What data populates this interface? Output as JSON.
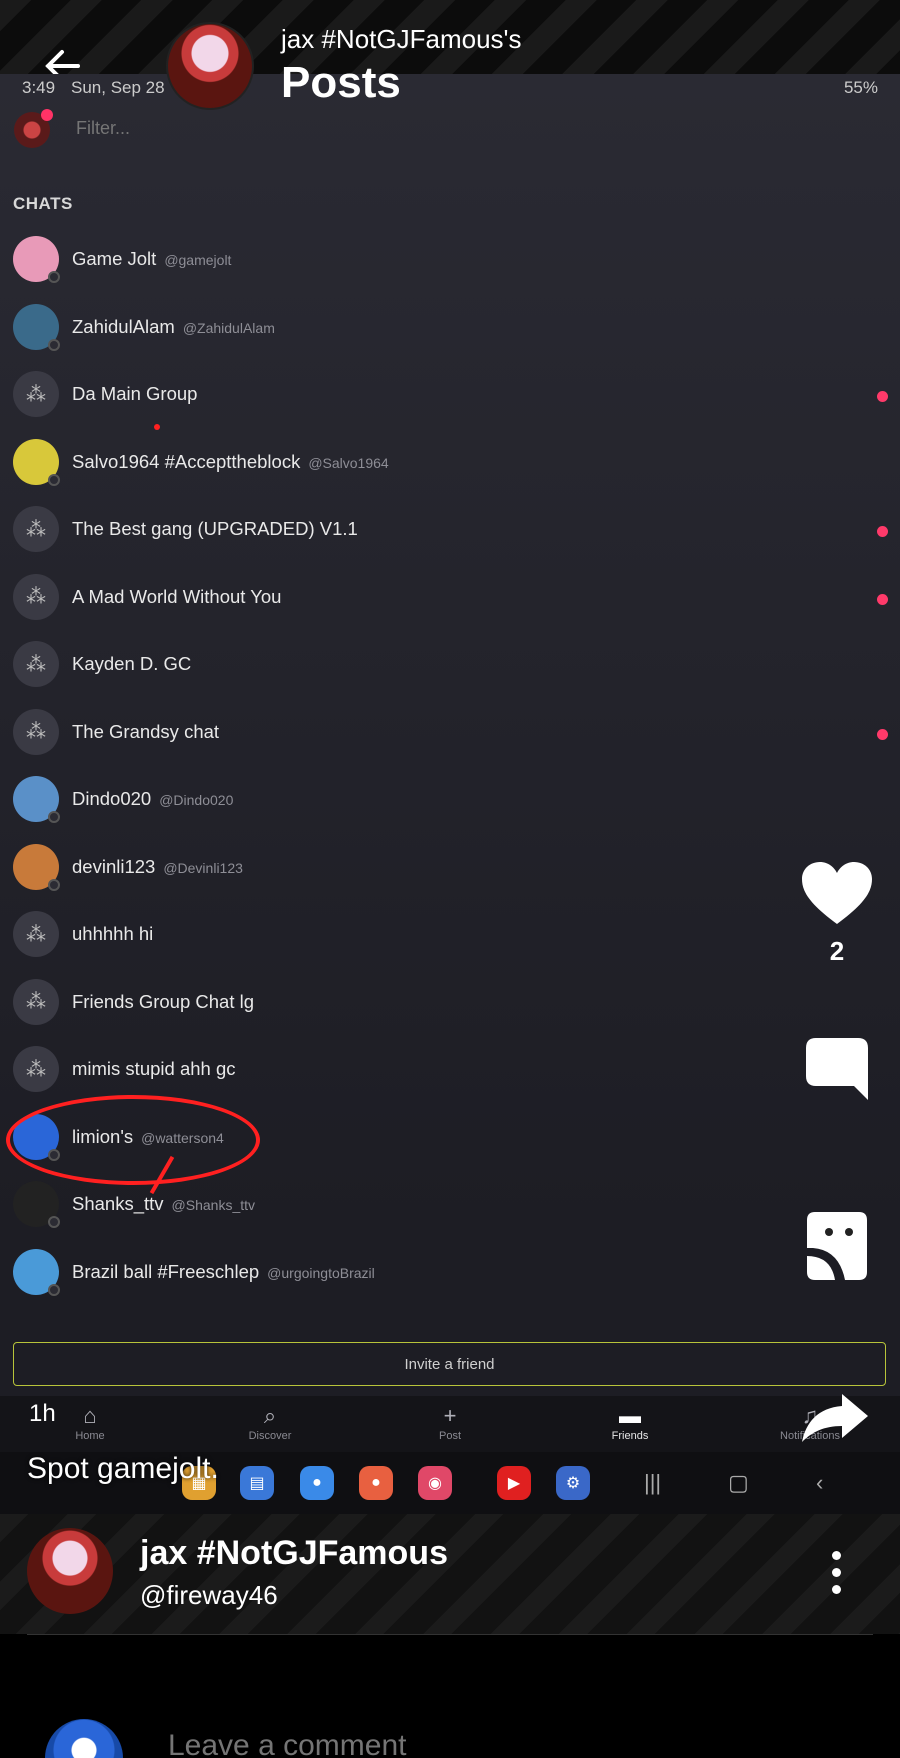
{
  "post": {
    "title": "jax #NotGJFamous's",
    "subtitle": "Posts",
    "age": "1h",
    "caption": "Spot gamejolt.",
    "likes": "2",
    "author_name": "jax #NotGJFamous",
    "author_handle": "@fireway46",
    "comment_placeholder": "Leave a comment"
  },
  "phone": {
    "time": "3:49",
    "date": "Sun, Sep 28",
    "battery": "55%",
    "filter_placeholder": "Filter...",
    "chats_label": "CHATS",
    "chats": [
      {
        "name": "Game Jolt",
        "handle": "@gamejolt",
        "unread": false
      },
      {
        "name": "ZahidulAlam",
        "handle": "@ZahidulAlam",
        "unread": false
      },
      {
        "name": "Da Main Group",
        "handle": "",
        "unread": true
      },
      {
        "name": "Salvo1964  #Accepttheblock",
        "handle": "@Salvo1964",
        "unread": false
      },
      {
        "name": "The Best gang (UPGRADED) V1.1",
        "handle": "",
        "unread": true
      },
      {
        "name": "A Mad World Without You",
        "handle": "",
        "unread": true
      },
      {
        "name": "Kayden D. GC",
        "handle": "",
        "unread": false
      },
      {
        "name": "The Grandsy chat",
        "handle": "",
        "unread": true
      },
      {
        "name": "Dindo020",
        "handle": "@Dindo020",
        "unread": false
      },
      {
        "name": "devinli123",
        "handle": "@Devinli123",
        "unread": false
      },
      {
        "name": "uhhhhh hi",
        "handle": "",
        "unread": false
      },
      {
        "name": "Friends Group Chat lg",
        "handle": "",
        "unread": false
      },
      {
        "name": "mimis stupid ahh gc",
        "handle": "",
        "unread": false
      },
      {
        "name": "limion's",
        "handle": "@watterson4",
        "unread": false
      },
      {
        "name": "Shanks_ttv",
        "handle": "@Shanks_ttv",
        "unread": false
      },
      {
        "name": "Brazil ball #Freeschlep",
        "handle": "@urgoingtoBrazil",
        "unread": false
      }
    ],
    "invite_label": "Invite a friend",
    "nav": {
      "home": "Home",
      "discover": "Discover",
      "post": "Post",
      "friends": "Friends",
      "notifications": "Notifications"
    }
  },
  "colors": {
    "unread_dot": "#ff3a6a",
    "highlight": "#ff2020",
    "invite_border": "#b8c43a"
  }
}
